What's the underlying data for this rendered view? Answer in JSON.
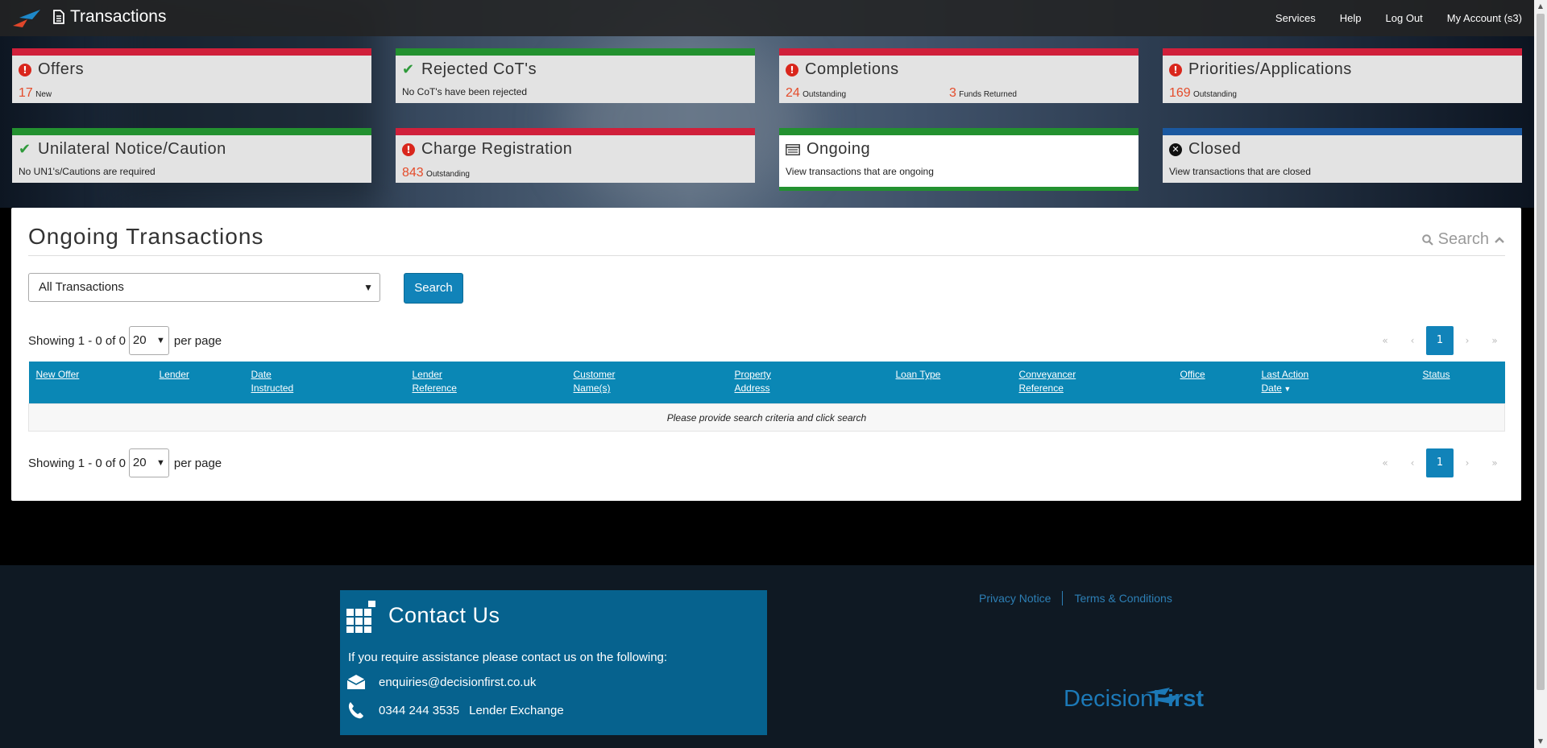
{
  "header": {
    "title": "Transactions",
    "nav": [
      "Services",
      "Help",
      "Log Out",
      "My Account (s3)"
    ]
  },
  "tiles": [
    {
      "title": "Offers",
      "status": "alert",
      "count": "17",
      "count_label": "New"
    },
    {
      "title": "Rejected CoT's",
      "status": "ok",
      "text": "No CoT's have been rejected"
    },
    {
      "title": "Completions",
      "status": "alert",
      "count": "24",
      "count_label": "Outstanding",
      "count2": "3",
      "count2_label": "Funds Returned"
    },
    {
      "title": "Priorities/Applications",
      "status": "alert",
      "count": "169",
      "count_label": "Outstanding"
    },
    {
      "title": "Unilateral Notice/Caution",
      "status": "ok",
      "text": "No UN1's/Cautions are required"
    },
    {
      "title": "Charge Registration",
      "status": "alert",
      "count": "843",
      "count_label": "Outstanding"
    },
    {
      "title": "Ongoing",
      "status": "list",
      "text": "View transactions that are ongoing"
    },
    {
      "title": "Closed",
      "status": "closed",
      "text": "View transactions that are closed"
    }
  ],
  "main": {
    "title": "Ongoing Transactions",
    "search_toggle": "Search",
    "filter_value": "All Transactions",
    "search_button": "Search",
    "showing": "Showing 1 - 0 of 0",
    "per_page_value": "20",
    "per_page_label": "per page",
    "pager": {
      "first": "«",
      "prev": "‹",
      "current": "1",
      "next": "›",
      "last": "»"
    },
    "columns": [
      "New Offer",
      "Lender",
      "Date\nInstructed",
      "Lender\nReference",
      "Customer\nName(s)",
      "Property\nAddress",
      "Loan Type",
      "Conveyancer\nReference",
      "Office",
      "Last Action\nDate",
      "Status"
    ],
    "empty_message": "Please provide search criteria and click search"
  },
  "footer": {
    "contact_title": "Contact Us",
    "contact_intro": "If you require assistance please contact us on the following:",
    "email": "enquiries@decisionfirst.co.uk",
    "phone": "0344 244 3535",
    "phone_label": "Lender Exchange",
    "links": [
      "Privacy Notice",
      "Terms & Conditions"
    ],
    "logo_part1": "Decision",
    "logo_part2": "First"
  },
  "colors": {
    "accent": "#1183b9",
    "alert": "#d0203b",
    "ok": "#239130",
    "closed": "#1a58a0",
    "count": "#e44c2b"
  }
}
